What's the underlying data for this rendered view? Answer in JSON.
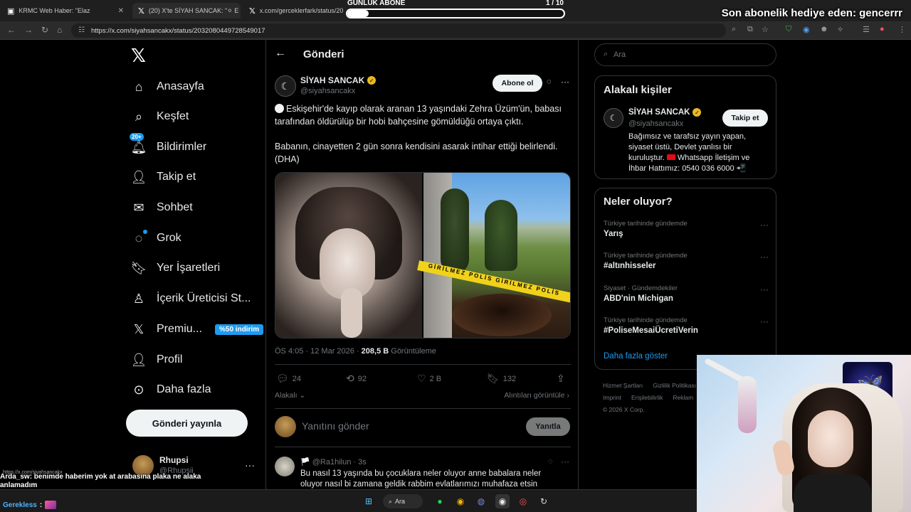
{
  "browser": {
    "tabs": [
      {
        "title": "KRMC Web Haber: \"Elaz",
        "active": false
      },
      {
        "title": "(20) X'te SİYAH SANCAK: \"⚪ E",
        "active": true
      },
      {
        "title": "x.com/gerceklerfark/status/203",
        "active": false
      }
    ],
    "url": "https://x.com/siyahsancakx/status/2032080449728549017"
  },
  "overlay": {
    "sub_goal_label": "GÜNLÜK ABONE",
    "sub_goal_count": "1 / 10",
    "sub_goal_progress": 0.1,
    "gift_text": "Son abonelik hediye eden: gencerrr"
  },
  "nav": {
    "items": [
      {
        "label": "Anasayfa",
        "icon": "home-icon"
      },
      {
        "label": "Keşfet",
        "icon": "search-icon"
      },
      {
        "label": "Bildirimler",
        "icon": "bell-icon",
        "badge": "20+"
      },
      {
        "label": "Takip et",
        "icon": "add-person-icon"
      },
      {
        "label": "Sohbet",
        "icon": "mail-icon"
      },
      {
        "label": "Grok",
        "icon": "grok-icon"
      },
      {
        "label": "Yer İşaretleri",
        "icon": "bookmark-icon"
      },
      {
        "label": "İçerik Üreticisi St...",
        "icon": "creator-icon"
      },
      {
        "label": "Premiu...",
        "icon": "x-icon",
        "promo": "%50 indirim"
      },
      {
        "label": "Profil",
        "icon": "person-icon"
      },
      {
        "label": "Daha fazla",
        "icon": "more-circle-icon"
      }
    ],
    "post_button": "Gönderi yayınla",
    "user_name": "Rhupsi",
    "user_handle": "@Rhupsii"
  },
  "post": {
    "header_title": "Gönderi",
    "author_name": "SİYAH SANCAK",
    "author_handle": "@siyahsancakx",
    "subscribe_label": "Abone ol",
    "text_1": "Eskişehir'de kayıp olarak aranan 13 yaşındaki Zehra Üzüm'ün, babası tarafından öldürülüp bir hobi bahçesine gömüldüğü ortaya çıktı.",
    "text_2": "Babanın, cinayetten 2 gün sonra kendisini asarak intihar ettiği belirlendi. (DHA)",
    "tape_text": "GİRİLMEZ POLİS GİRİLMEZ POLİS",
    "time": "ÖS 4:05 · 12 Mar 2026 · ",
    "views": "208,5 B",
    "views_label": " Görüntüleme",
    "replies": "24",
    "reposts": "92",
    "likes": "2 B",
    "bookmarks": "132",
    "related_label": "Alakalı",
    "quotes_label": "Alıntıları görüntüle",
    "reply_placeholder": "Yanıtını gönder",
    "reply_button": "Yanıtla"
  },
  "reply": {
    "header": "🏳️ @Ra1hilun · 3s",
    "text": "Bu nasıl 13 yaşında bu çocuklara neler oluyor anne babalara neler oluyor nasıl bi zamana geldik rabbim evlatlarımızı muhafaza etsin"
  },
  "right": {
    "search_placeholder": "Ara",
    "related_title": "Alakalı kişiler",
    "rel_name": "SİYAH SANCAK",
    "rel_handle": "@siyahsancakx",
    "follow_label": "Takip et",
    "bio_1": "Bağımsız ve tarafsız yayın yapan, siyaset üstü, Devlet yanlısı bir kuruluştur. ",
    "bio_2": " Whatsapp İletişim ve İhbar Hattımız: 0540 036 6000 📲",
    "trends_title": "Neler oluyor?",
    "trends": [
      {
        "context": "Türkiye tarihinde gündemde",
        "topic": "Yarış"
      },
      {
        "context": "Türkiye tarihinde gündemde",
        "topic": "#altınhisseler"
      },
      {
        "context": "Siyaset · Gündemdekiler",
        "topic": "ABD'nin Michigan"
      },
      {
        "context": "Türkiye tarihinde gündemde",
        "topic": "#PoliseMesaiÜcretiVerin"
      }
    ],
    "show_more": "Daha fazla göster",
    "footer": [
      "Hizmet Şartları",
      "Gizlilik Politikası",
      "Imprint",
      "Erişilebilirlik",
      "Reklam",
      "© 2026 X Corp."
    ]
  },
  "chat": {
    "small_url": "https://x.com/siyahsancakx",
    "line1_user": "Arda_sw",
    "line1_text": ": benimde haberim yok at arabasına plaka ne alaka anlamadım",
    "line2_user": "Gerekless",
    "line2_sep": ":"
  },
  "taskbar": {
    "search_label": "Ara"
  }
}
